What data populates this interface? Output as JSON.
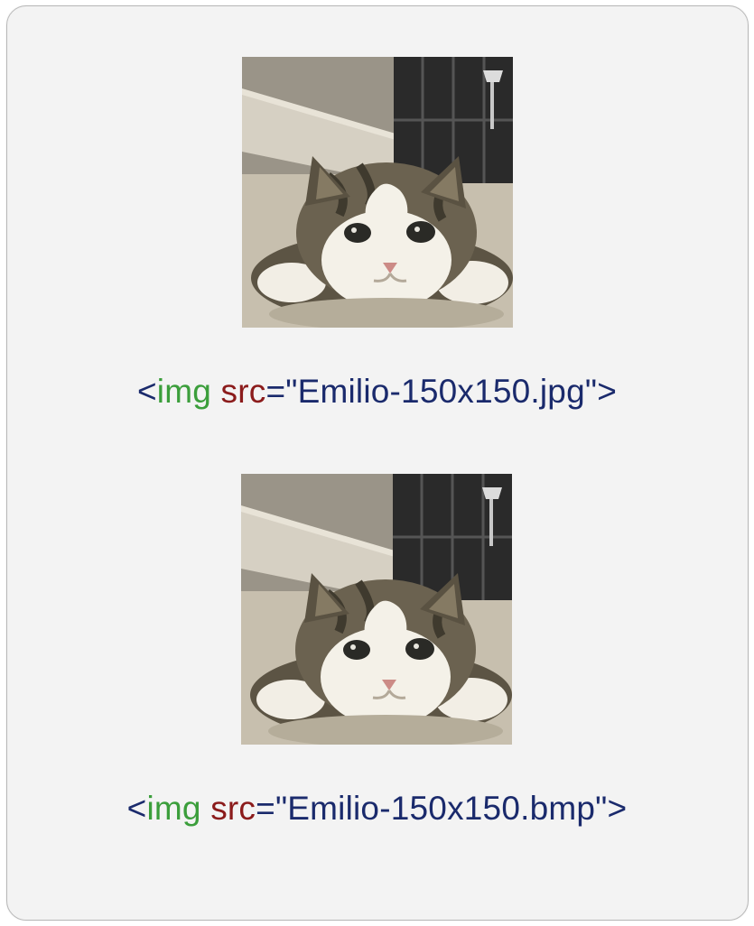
{
  "examples": [
    {
      "angle_open": "<",
      "tag": "img",
      "attr": "src",
      "equals": "=",
      "string": "\"Emilio-150x150.jpg\"",
      "angle_close": ">",
      "image_alt": "cat-photo"
    },
    {
      "angle_open": "<",
      "tag": "img",
      "attr": "src",
      "equals": "=",
      "string": "\"Emilio-150x150.bmp\"",
      "angle_close": ">",
      "image_alt": "cat-photo"
    }
  ]
}
